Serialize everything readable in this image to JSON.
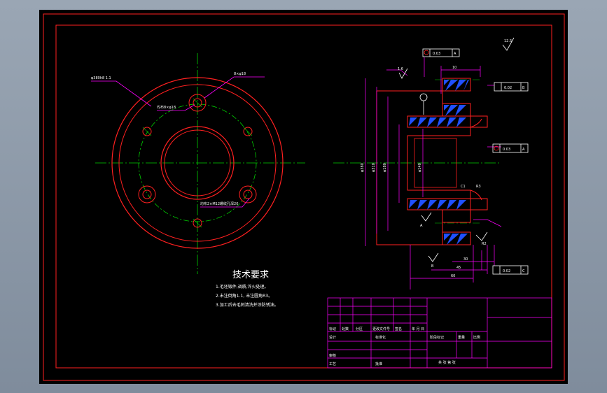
{
  "tech": {
    "title": "技术要求",
    "notes": [
      "1.毛坯锻件,调质,淬火处理。",
      "2.未注倒角1.1, 未注圆角R3。",
      "3.加工后去毛刺清洗并涂防锈油。"
    ]
  },
  "plan_labels": {
    "outer_dia": "φ380h8 1.1",
    "hole_top": "8×φ18",
    "pcd_label": "均布8×φ18",
    "bottom_label": "均布2×M12螺纹孔深20"
  },
  "section_labels": {
    "datum_a": "A",
    "datum_b": "B",
    "datum_c": "C",
    "roughness_top": "12.5",
    "roughness_left": "1.6",
    "roughness_r": "R2",
    "runout_top": "0.03",
    "runout_mid": "0.03",
    "flatness": "0.02",
    "runout_bottom": "0.02",
    "perp_right": "0.03",
    "dim_top": "10",
    "dim_left_outer": "φ380",
    "dim_left_mid": "φ310",
    "dim_left_in": "φ180",
    "dim_bore": "φ140",
    "dim_c": "C1",
    "dim_r": "R3",
    "dim_bottom1": "30",
    "dim_bottom2": "45",
    "dim_bottom3": "60"
  },
  "title_block": {
    "r_mark": "标记",
    "r_count": "处数",
    "r_zone": "分区",
    "r_doc": "更改文件号",
    "r_sign": "签名",
    "r_date": "年 月 日",
    "designer": "设计",
    "standard": "标准化",
    "stage": "阶段标记",
    "weight": "重量",
    "scale": "比例",
    "checker": "审核",
    "process": "工艺",
    "approve": "批准",
    "sheets": "共  张 第  张"
  }
}
